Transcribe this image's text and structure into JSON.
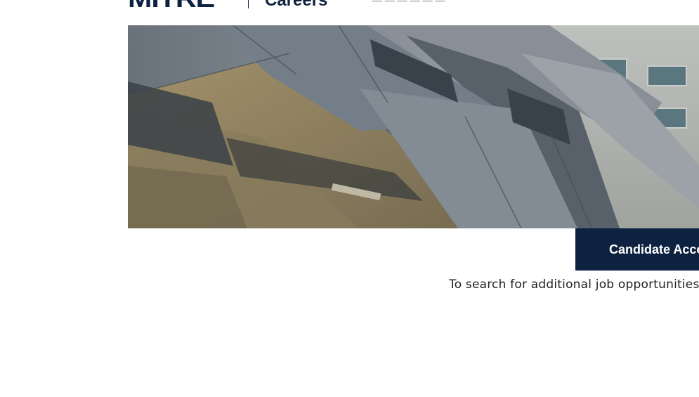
{
  "header": {
    "logo_text": "MITRE",
    "section_title": "Careers",
    "subnav_text": "— — — — — —"
  },
  "hero": {
    "image_icon": "building-photo"
  },
  "actions": {
    "candidate_account_label": "Candidate Acco"
  },
  "main": {
    "hint_text": "To search for additional job opportunities"
  },
  "colors": {
    "brand_navy": "#0d2240",
    "text": "#222222"
  }
}
